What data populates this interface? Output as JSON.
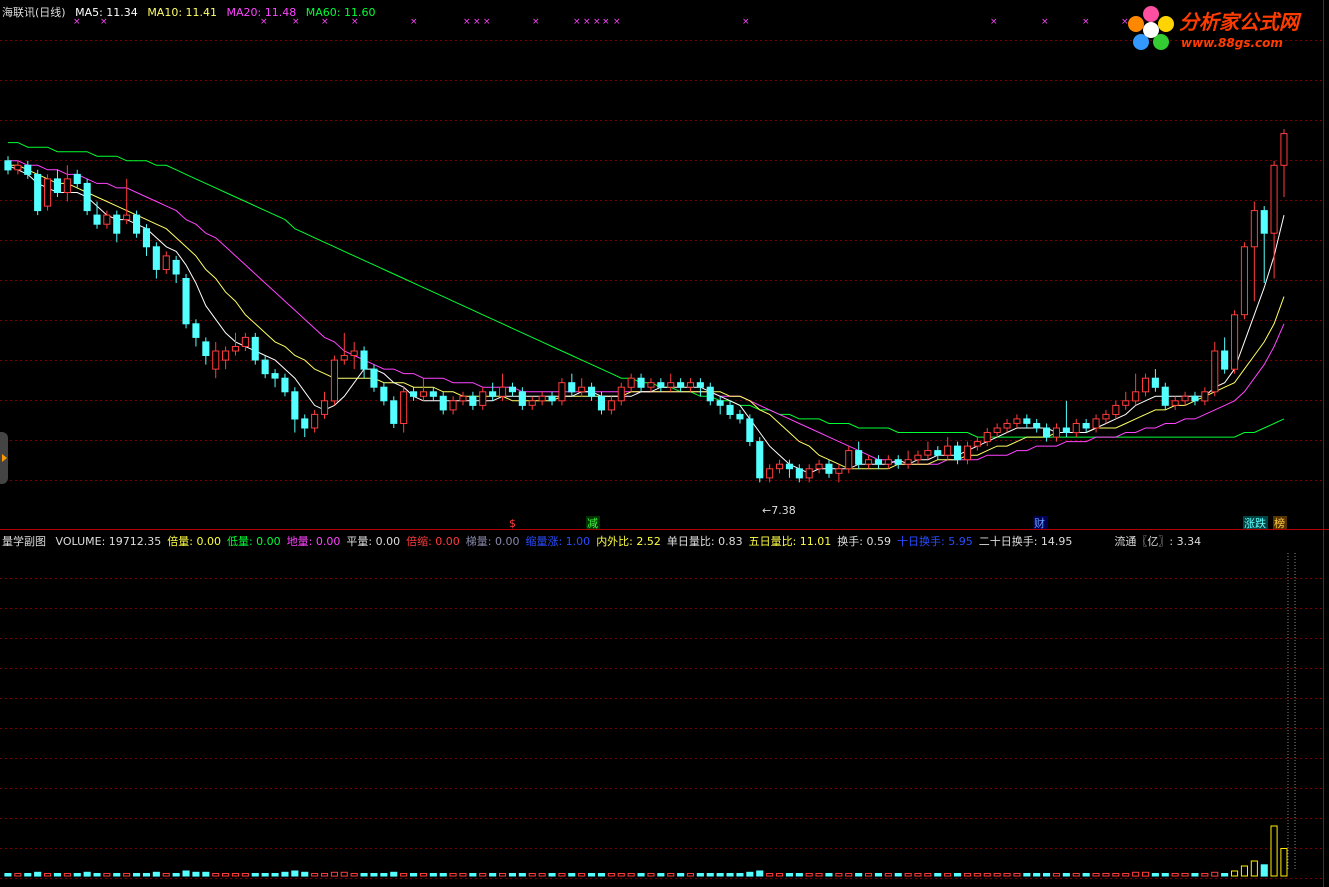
{
  "header": {
    "title": "海联讯(日线)",
    "ma5": "MA5: 11.34",
    "ma10": "MA10: 11.41",
    "ma20": "MA20: 11.48",
    "ma60": "MA60: 11.60"
  },
  "colors": {
    "up": "#ff3c3c",
    "down": "#54ffff",
    "ma5": "#ffffff",
    "ma10": "#ffff66",
    "ma20": "#ff44ff",
    "ma60": "#00ff33",
    "grid": "#7a0000"
  },
  "logo": {
    "name": "分析家公式网",
    "url": "www.88gs.com"
  },
  "annotations": {
    "low_label": "←7.38",
    "marker_dollar": "$",
    "marker_jian": "减",
    "marker_cai": "财",
    "marker_zhangdie": "涨跌",
    "marker_bang": "榜"
  },
  "volume_panel": {
    "title": "量学副图",
    "items": [
      {
        "label": "VOLUME: 19712.35",
        "color": "#dddddd"
      },
      {
        "label": "倍量: 0.00",
        "color": "#ffff44"
      },
      {
        "label": "低量: 0.00",
        "color": "#00ff33"
      },
      {
        "label": "地量: 0.00",
        "color": "#ff44ff"
      },
      {
        "label": "平量: 0.00",
        "color": "#dddddd"
      },
      {
        "label": "倍缩: 0.00",
        "color": "#ff3c3c"
      },
      {
        "label": "梯量: 0.00",
        "color": "#8888aa"
      },
      {
        "label": "缩量涨: 1.00",
        "color": "#2a4cff"
      },
      {
        "label": "内外比: 2.52",
        "color": "#ffff44"
      },
      {
        "label": "单日量比: 0.83",
        "color": "#dddddd"
      },
      {
        "label": "五日量比: 11.01",
        "color": "#ffff44"
      },
      {
        "label": "换手: 0.59",
        "color": "#dddddd"
      },
      {
        "label": "十日换手: 5.95",
        "color": "#2a4cff"
      },
      {
        "label": "二十日换手: 14.95",
        "color": "#dddddd"
      },
      {
        "label": "流通〖亿〗: 3.34",
        "color": "#dddddd"
      }
    ]
  },
  "chart_data": {
    "type": "candlestick",
    "low_value": 7.38,
    "candles": [
      [
        11.6,
        11.4,
        11.7,
        11.3
      ],
      [
        11.4,
        11.5,
        11.6,
        11.3
      ],
      [
        11.5,
        11.3,
        11.6,
        11.2
      ],
      [
        11.3,
        10.5,
        11.4,
        10.4
      ],
      [
        10.6,
        11.2,
        11.3,
        10.5
      ],
      [
        11.2,
        10.9,
        11.4,
        10.8
      ],
      [
        10.9,
        11.2,
        11.5,
        10.7
      ],
      [
        11.3,
        11.1,
        11.4,
        11.0
      ],
      [
        11.1,
        10.5,
        11.2,
        10.4
      ],
      [
        10.4,
        10.2,
        10.7,
        10.1
      ],
      [
        10.2,
        10.4,
        10.5,
        10.1
      ],
      [
        10.4,
        10.0,
        10.5,
        9.8
      ],
      [
        10.3,
        10.4,
        11.2,
        10.2
      ],
      [
        10.4,
        10.0,
        10.5,
        9.9
      ],
      [
        10.1,
        9.7,
        10.2,
        9.5
      ],
      [
        9.7,
        9.2,
        9.8,
        9.0
      ],
      [
        9.2,
        9.5,
        9.6,
        9.1
      ],
      [
        9.4,
        9.1,
        9.5,
        8.9
      ],
      [
        9.0,
        8.0,
        9.1,
        7.9
      ],
      [
        8.0,
        7.7,
        8.1,
        7.5
      ],
      [
        7.6,
        7.3,
        7.7,
        7.1
      ],
      [
        7.0,
        7.4,
        7.6,
        6.8
      ],
      [
        7.2,
        7.4,
        7.5,
        7.0
      ],
      [
        7.4,
        7.5,
        7.8,
        7.3
      ],
      [
        7.5,
        7.7,
        7.8,
        7.4
      ],
      [
        7.7,
        7.2,
        7.8,
        7.1
      ],
      [
        7.2,
        6.9,
        7.3,
        6.8
      ],
      [
        6.9,
        6.8,
        7.0,
        6.6
      ],
      [
        6.8,
        6.5,
        6.9,
        6.4
      ],
      [
        6.5,
        5.9,
        6.6,
        5.6
      ],
      [
        5.9,
        5.7,
        6.0,
        5.5
      ],
      [
        5.7,
        6.0,
        6.1,
        5.6
      ],
      [
        6.0,
        6.3,
        6.5,
        5.9
      ],
      [
        6.3,
        7.2,
        7.3,
        6.2
      ],
      [
        7.2,
        7.3,
        7.8,
        7.1
      ],
      [
        7.3,
        7.4,
        7.6,
        7.0
      ],
      [
        7.4,
        7.0,
        7.5,
        6.8
      ],
      [
        7.0,
        6.6,
        7.1,
        6.5
      ],
      [
        6.6,
        6.3,
        6.7,
        6.2
      ],
      [
        6.3,
        5.8,
        6.4,
        5.7
      ],
      [
        5.8,
        6.5,
        6.6,
        5.6
      ],
      [
        6.5,
        6.4,
        6.6,
        6.3
      ],
      [
        6.4,
        6.5,
        6.8,
        6.3
      ],
      [
        6.5,
        6.4,
        6.6,
        6.3
      ],
      [
        6.4,
        6.1,
        6.5,
        6.0
      ],
      [
        6.1,
        6.3,
        6.4,
        6.0
      ],
      [
        6.3,
        6.4,
        6.5,
        6.2
      ],
      [
        6.4,
        6.2,
        6.5,
        6.1
      ],
      [
        6.2,
        6.5,
        6.6,
        6.1
      ],
      [
        6.5,
        6.4,
        6.7,
        6.3
      ],
      [
        6.4,
        6.6,
        6.9,
        6.3
      ],
      [
        6.6,
        6.5,
        6.7,
        6.4
      ],
      [
        6.5,
        6.2,
        6.6,
        6.1
      ],
      [
        6.2,
        6.3,
        6.4,
        6.1
      ],
      [
        6.3,
        6.4,
        6.5,
        6.2
      ],
      [
        6.4,
        6.3,
        6.5,
        6.2
      ],
      [
        6.3,
        6.7,
        6.8,
        6.2
      ],
      [
        6.7,
        6.5,
        6.9,
        6.4
      ],
      [
        6.5,
        6.6,
        6.8,
        6.4
      ],
      [
        6.6,
        6.4,
        6.7,
        6.3
      ],
      [
        6.4,
        6.1,
        6.5,
        6.0
      ],
      [
        6.1,
        6.3,
        6.4,
        6.0
      ],
      [
        6.3,
        6.6,
        6.7,
        6.2
      ],
      [
        6.6,
        6.8,
        6.9,
        6.5
      ],
      [
        6.8,
        6.6,
        6.9,
        6.5
      ],
      [
        6.6,
        6.7,
        6.8,
        6.5
      ],
      [
        6.7,
        6.6,
        6.8,
        6.5
      ],
      [
        6.6,
        6.7,
        6.9,
        6.5
      ],
      [
        6.7,
        6.6,
        6.8,
        6.5
      ],
      [
        6.6,
        6.7,
        6.8,
        6.5
      ],
      [
        6.7,
        6.6,
        6.8,
        6.4
      ],
      [
        6.6,
        6.3,
        6.7,
        6.2
      ],
      [
        6.3,
        6.2,
        6.4,
        6.0
      ],
      [
        6.2,
        6.0,
        6.3,
        5.9
      ],
      [
        6.0,
        5.9,
        6.1,
        5.8
      ],
      [
        5.9,
        5.4,
        6.0,
        5.3
      ],
      [
        5.4,
        4.6,
        5.5,
        4.5
      ],
      [
        4.6,
        4.8,
        4.9,
        4.5
      ],
      [
        4.8,
        4.9,
        5.0,
        4.7
      ],
      [
        4.9,
        4.8,
        5.0,
        4.6
      ],
      [
        4.8,
        4.6,
        4.9,
        4.5
      ],
      [
        4.6,
        4.8,
        4.9,
        4.5
      ],
      [
        4.8,
        4.9,
        5.0,
        4.7
      ],
      [
        4.9,
        4.7,
        5.0,
        4.6
      ],
      [
        4.7,
        4.8,
        4.9,
        4.5
      ],
      [
        4.8,
        5.2,
        5.3,
        4.7
      ],
      [
        5.2,
        4.9,
        5.4,
        4.8
      ],
      [
        4.9,
        5.0,
        5.1,
        4.8
      ],
      [
        5.0,
        4.9,
        5.1,
        4.8
      ],
      [
        4.9,
        5.0,
        5.1,
        4.8
      ],
      [
        5.0,
        4.9,
        5.1,
        4.8
      ],
      [
        4.9,
        5.0,
        5.2,
        4.8
      ],
      [
        5.0,
        5.1,
        5.2,
        4.9
      ],
      [
        5.1,
        5.2,
        5.4,
        5.0
      ],
      [
        5.2,
        5.1,
        5.3,
        5.0
      ],
      [
        5.1,
        5.3,
        5.5,
        5.0
      ],
      [
        5.3,
        5.0,
        5.4,
        4.9
      ],
      [
        5.0,
        5.3,
        5.4,
        4.9
      ],
      [
        5.3,
        5.4,
        5.5,
        5.2
      ],
      [
        5.4,
        5.6,
        5.7,
        5.3
      ],
      [
        5.6,
        5.7,
        5.8,
        5.5
      ],
      [
        5.7,
        5.8,
        5.9,
        5.6
      ],
      [
        5.8,
        5.9,
        6.0,
        5.7
      ],
      [
        5.9,
        5.8,
        6.0,
        5.7
      ],
      [
        5.8,
        5.7,
        5.9,
        5.6
      ],
      [
        5.7,
        5.5,
        5.8,
        5.4
      ],
      [
        5.5,
        5.7,
        5.8,
        5.4
      ],
      [
        5.7,
        5.6,
        6.3,
        5.5
      ],
      [
        5.6,
        5.8,
        5.9,
        5.5
      ],
      [
        5.8,
        5.7,
        5.9,
        5.6
      ],
      [
        5.7,
        5.9,
        6.0,
        5.6
      ],
      [
        5.9,
        6.0,
        6.1,
        5.8
      ],
      [
        6.0,
        6.2,
        6.3,
        5.9
      ],
      [
        6.2,
        6.3,
        6.5,
        6.1
      ],
      [
        6.3,
        6.5,
        6.9,
        6.2
      ],
      [
        6.5,
        6.8,
        6.9,
        6.4
      ],
      [
        6.8,
        6.6,
        7.0,
        6.5
      ],
      [
        6.6,
        6.2,
        6.7,
        6.1
      ],
      [
        6.2,
        6.3,
        6.4,
        6.1
      ],
      [
        6.3,
        6.4,
        6.5,
        6.2
      ],
      [
        6.4,
        6.3,
        6.5,
        6.2
      ],
      [
        6.3,
        6.5,
        6.6,
        6.2
      ],
      [
        6.5,
        7.4,
        7.6,
        6.4
      ],
      [
        7.4,
        7.0,
        7.7,
        6.9
      ],
      [
        7.0,
        8.2,
        8.3,
        6.9
      ],
      [
        8.2,
        9.7,
        9.8,
        8.1
      ],
      [
        9.7,
        10.5,
        10.7,
        8.5
      ],
      [
        10.5,
        10.0,
        10.6,
        8.9
      ],
      [
        10.0,
        11.5,
        11.6,
        9.0
      ],
      [
        11.5,
        12.2,
        12.3,
        10.8
      ]
    ],
    "ma5": [
      11.5,
      11.4,
      11.3,
      11.1,
      11.0,
      10.9,
      10.9,
      10.9,
      10.8,
      10.6,
      10.4,
      10.3,
      10.3,
      10.2,
      10.1,
      9.9,
      9.7,
      9.6,
      9.3,
      8.9,
      8.4,
      8.1,
      7.8,
      7.6,
      7.5,
      7.4,
      7.3,
      7.2,
      7.0,
      6.8,
      6.5,
      6.2,
      6.1,
      6.2,
      6.4,
      6.7,
      7.0,
      7.0,
      6.9,
      6.7,
      6.6,
      6.4,
      6.3,
      6.3,
      6.3,
      6.3,
      6.3,
      6.3,
      6.3,
      6.3,
      6.4,
      6.4,
      6.4,
      6.4,
      6.4,
      6.4,
      6.4,
      6.4,
      6.5,
      6.5,
      6.4,
      6.4,
      6.4,
      6.4,
      6.5,
      6.5,
      6.6,
      6.6,
      6.6,
      6.6,
      6.6,
      6.5,
      6.4,
      6.3,
      6.2,
      5.9,
      5.6,
      5.3,
      5.1,
      4.9,
      4.8,
      4.7,
      4.8,
      4.8,
      4.8,
      4.8,
      4.9,
      4.9,
      4.9,
      4.9,
      5.0,
      4.9,
      5.0,
      5.0,
      5.1,
      5.1,
      5.1,
      5.2,
      5.3,
      5.4,
      5.5,
      5.6,
      5.7,
      5.7,
      5.7,
      5.7,
      5.6,
      5.6,
      5.6,
      5.6,
      5.7,
      5.8,
      5.9,
      6.0,
      6.2,
      6.3,
      6.4,
      6.4,
      6.4,
      6.4,
      6.4,
      6.4,
      6.6,
      6.7,
      7.0,
      7.6,
      8.2,
      8.8,
      9.5,
      10.4
    ],
    "ma10": [
      11.5,
      11.5,
      11.4,
      11.3,
      11.2,
      11.1,
      11.1,
      11.0,
      10.9,
      10.8,
      10.7,
      10.6,
      10.5,
      10.4,
      10.3,
      10.2,
      10.1,
      9.9,
      9.7,
      9.5,
      9.2,
      9.0,
      8.7,
      8.5,
      8.2,
      8.0,
      7.8,
      7.6,
      7.5,
      7.3,
      7.2,
      7.0,
      6.9,
      6.8,
      6.8,
      6.8,
      6.8,
      6.8,
      6.7,
      6.7,
      6.7,
      6.6,
      6.6,
      6.6,
      6.5,
      6.5,
      6.4,
      6.4,
      6.4,
      6.4,
      6.4,
      6.3,
      6.3,
      6.3,
      6.3,
      6.3,
      6.4,
      6.4,
      6.4,
      6.4,
      6.4,
      6.4,
      6.4,
      6.5,
      6.5,
      6.5,
      6.5,
      6.5,
      6.5,
      6.5,
      6.5,
      6.5,
      6.5,
      6.4,
      6.4,
      6.3,
      6.1,
      6.0,
      5.8,
      5.6,
      5.4,
      5.3,
      5.1,
      5.0,
      4.9,
      4.8,
      4.8,
      4.8,
      4.8,
      4.8,
      4.9,
      4.9,
      4.9,
      4.9,
      5.0,
      5.0,
      5.0,
      5.1,
      5.1,
      5.2,
      5.3,
      5.3,
      5.4,
      5.5,
      5.5,
      5.5,
      5.6,
      5.6,
      5.6,
      5.6,
      5.7,
      5.7,
      5.7,
      5.8,
      5.9,
      6.0,
      6.1,
      6.1,
      6.2,
      6.2,
      6.3,
      6.4,
      6.5,
      6.6,
      6.7,
      7.0,
      7.3,
      7.6,
      8.0,
      8.6
    ],
    "ma20": [
      11.6,
      11.6,
      11.5,
      11.5,
      11.4,
      11.4,
      11.3,
      11.3,
      11.2,
      11.1,
      11.1,
      11.0,
      11.0,
      10.9,
      10.8,
      10.7,
      10.6,
      10.5,
      10.3,
      10.2,
      10.0,
      9.9,
      9.7,
      9.5,
      9.3,
      9.1,
      8.9,
      8.7,
      8.5,
      8.3,
      8.1,
      7.9,
      7.7,
      7.6,
      7.4,
      7.3,
      7.2,
      7.1,
      7.0,
      7.0,
      6.9,
      6.9,
      6.8,
      6.8,
      6.8,
      6.7,
      6.7,
      6.7,
      6.6,
      6.6,
      6.6,
      6.6,
      6.5,
      6.5,
      6.5,
      6.5,
      6.5,
      6.5,
      6.5,
      6.5,
      6.5,
      6.5,
      6.5,
      6.5,
      6.5,
      6.5,
      6.5,
      6.5,
      6.5,
      6.5,
      6.5,
      6.5,
      6.4,
      6.4,
      6.4,
      6.3,
      6.2,
      6.1,
      6.0,
      5.9,
      5.8,
      5.7,
      5.6,
      5.5,
      5.4,
      5.3,
      5.2,
      5.1,
      5.0,
      5.0,
      4.9,
      4.9,
      4.9,
      4.9,
      4.9,
      5.0,
      5.0,
      5.0,
      5.0,
      5.1,
      5.1,
      5.1,
      5.2,
      5.2,
      5.3,
      5.3,
      5.3,
      5.4,
      5.4,
      5.4,
      5.5,
      5.5,
      5.5,
      5.6,
      5.6,
      5.7,
      5.7,
      5.8,
      5.8,
      5.9,
      5.9,
      6.0,
      6.1,
      6.2,
      6.3,
      6.5,
      6.8,
      7.1,
      7.5,
      8.0
    ],
    "ma60": [
      12.0,
      12.0,
      11.9,
      11.9,
      11.9,
      11.8,
      11.8,
      11.8,
      11.8,
      11.7,
      11.7,
      11.7,
      11.6,
      11.6,
      11.6,
      11.5,
      11.5,
      11.4,
      11.3,
      11.2,
      11.1,
      11.0,
      10.9,
      10.8,
      10.7,
      10.6,
      10.5,
      10.4,
      10.3,
      10.1,
      10.0,
      9.9,
      9.8,
      9.7,
      9.6,
      9.5,
      9.4,
      9.3,
      9.2,
      9.1,
      9.0,
      8.9,
      8.8,
      8.7,
      8.6,
      8.5,
      8.4,
      8.3,
      8.2,
      8.1,
      8.0,
      7.9,
      7.8,
      7.7,
      7.6,
      7.5,
      7.4,
      7.3,
      7.2,
      7.1,
      7.0,
      6.9,
      6.8,
      6.8,
      6.7,
      6.7,
      6.6,
      6.6,
      6.5,
      6.5,
      6.4,
      6.4,
      6.3,
      6.3,
      6.2,
      6.2,
      6.1,
      6.1,
      6.0,
      6.0,
      5.9,
      5.9,
      5.9,
      5.8,
      5.8,
      5.8,
      5.7,
      5.7,
      5.7,
      5.7,
      5.6,
      5.6,
      5.6,
      5.6,
      5.6,
      5.6,
      5.6,
      5.6,
      5.5,
      5.5,
      5.5,
      5.5,
      5.5,
      5.5,
      5.5,
      5.5,
      5.5,
      5.5,
      5.5,
      5.5,
      5.5,
      5.5,
      5.5,
      5.5,
      5.5,
      5.5,
      5.5,
      5.5,
      5.5,
      5.5,
      5.5,
      5.5,
      5.5,
      5.5,
      5.5,
      5.6,
      5.6,
      5.7,
      5.8,
      5.9
    ],
    "volumes": [
      2,
      2,
      2,
      3,
      2,
      2,
      2,
      2,
      3,
      2,
      2,
      2,
      2,
      2,
      2,
      3,
      2,
      2,
      4,
      3,
      3,
      2,
      2,
      2,
      2,
      2,
      2,
      2,
      3,
      4,
      3,
      2,
      2,
      3,
      3,
      2,
      2,
      2,
      2,
      3,
      2,
      2,
      2,
      2,
      2,
      2,
      2,
      2,
      2,
      2,
      2,
      2,
      2,
      2,
      2,
      2,
      2,
      2,
      2,
      2,
      2,
      2,
      2,
      2,
      2,
      2,
      2,
      2,
      2,
      2,
      2,
      2,
      2,
      2,
      2,
      3,
      4,
      2,
      2,
      2,
      2,
      2,
      2,
      2,
      2,
      2,
      2,
      2,
      2,
      2,
      2,
      2,
      2,
      2,
      2,
      2,
      2,
      2,
      2,
      2,
      2,
      2,
      2,
      2,
      2,
      2,
      2,
      2,
      2,
      2,
      2,
      2,
      2,
      2,
      3,
      3,
      2,
      2,
      2,
      2,
      2,
      2,
      3,
      2,
      4,
      8,
      12,
      9,
      40,
      22
    ]
  }
}
